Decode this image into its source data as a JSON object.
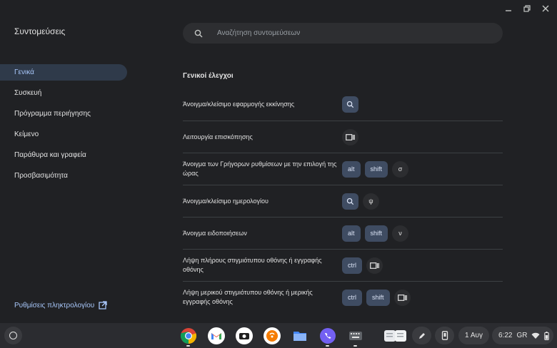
{
  "window": {
    "title": "Συντομεύσεις"
  },
  "sidebar": {
    "items": [
      {
        "label": "Γενικά",
        "active": true
      },
      {
        "label": "Συσκευή"
      },
      {
        "label": "Πρόγραμμα περιήγησης"
      },
      {
        "label": "Κείμενο"
      },
      {
        "label": "Παράθυρα και γραφεία"
      },
      {
        "label": "Προσβασιμότητα"
      }
    ],
    "keyboard_settings_label": "Ρυθμίσεις πληκτρολογίου"
  },
  "search": {
    "placeholder": "Αναζήτηση συντομεύσεων"
  },
  "section": {
    "title": "Γενικοί έλεγχοι",
    "shortcuts": [
      {
        "description": "Άνοιγμα/κλείσιμο εφαρμογής εκκίνησης",
        "keys": [
          {
            "icon": "search-icon"
          }
        ]
      },
      {
        "description": "Λειτουργία επισκόπησης",
        "keys": [
          {
            "icon": "overview-icon",
            "plain": true
          }
        ]
      },
      {
        "description": "Άνοιγμα των Γρήγορων ρυθμίσεων με την επιλογή της ώρας",
        "keys": [
          {
            "label": "alt"
          },
          {
            "label": "shift"
          },
          {
            "label": "σ",
            "plain": true
          }
        ]
      },
      {
        "description": "Άνοιγμα/κλείσιμο ημερολογίου",
        "keys": [
          {
            "icon": "search-icon"
          },
          {
            "label": "ψ",
            "plain": true
          }
        ]
      },
      {
        "description": "Άνοιγμα ειδοποιήσεων",
        "keys": [
          {
            "label": "alt"
          },
          {
            "label": "shift"
          },
          {
            "label": "ν",
            "plain": true
          }
        ]
      },
      {
        "description": "Λήψη πλήρους στιγμιότυπου οθόνης ή εγγραφής οθόνης",
        "keys": [
          {
            "label": "ctrl"
          },
          {
            "icon": "overview-icon",
            "plain": true
          }
        ]
      },
      {
        "description": "Λήψη μερικού στιγμιότυπου οθόνης ή μερικής εγγραφής οθόνης",
        "keys": [
          {
            "label": "ctrl"
          },
          {
            "label": "shift"
          },
          {
            "icon": "overview-icon",
            "plain": true
          }
        ]
      }
    ]
  },
  "shelf": {
    "apps": [
      {
        "name": "chrome-app",
        "icon": "chrome-icon",
        "running": true
      },
      {
        "name": "gmail-app",
        "icon": "gmail-icon",
        "running": false
      },
      {
        "name": "screencast-app",
        "icon": "screencast-icon",
        "running": false
      },
      {
        "name": "podcasts-app",
        "icon": "podcasts-icon",
        "running": false
      },
      {
        "name": "files-app",
        "icon": "files-icon",
        "running": false
      },
      {
        "name": "viber-app",
        "icon": "viber-icon",
        "running": true
      },
      {
        "name": "shortcuts-app",
        "icon": "shortcuts-icon",
        "running": true
      }
    ],
    "date": "1 Αυγ",
    "time": "6:22",
    "locale": "GR"
  },
  "colors": {
    "background": "#202124",
    "accent": "#a8c7fa",
    "key_bg": "#3f4c62"
  }
}
